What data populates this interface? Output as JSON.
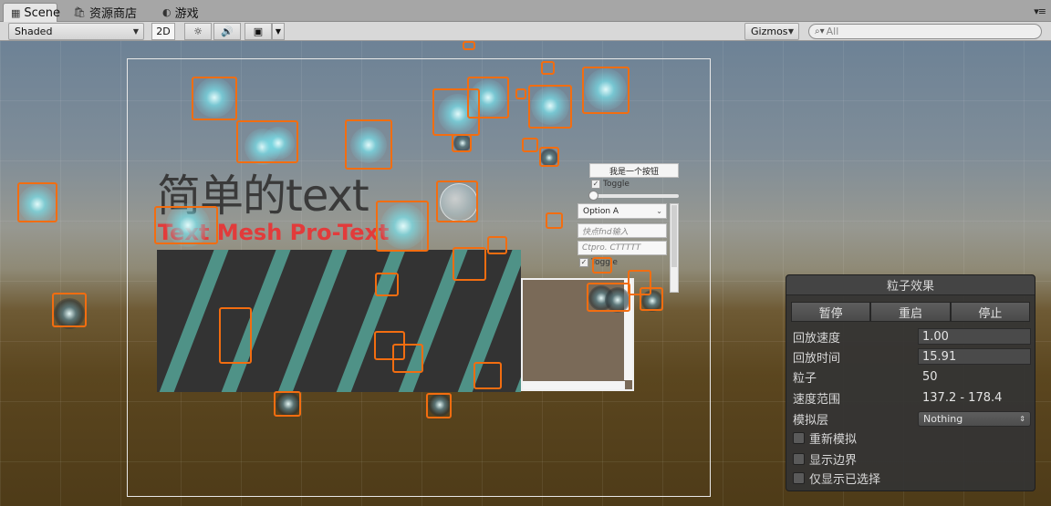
{
  "tabs": [
    {
      "label": "Scene",
      "icon": "scene-icon"
    },
    {
      "label": "资源商店",
      "icon": "store-icon"
    },
    {
      "label": "游戏",
      "icon": "game-icon"
    }
  ],
  "toolbar": {
    "shading_mode": "Shaded",
    "mode_2d": "2D",
    "gizmos": "Gizmos",
    "search_placeholder": "All"
  },
  "scene": {
    "big_text": "简单的text",
    "tmp_text": "Text Mesh Pro-Text",
    "ui_button": "我是一个按钮",
    "ui_toggle_1": "Toggle",
    "ui_dropdown": "Option A",
    "ui_input_1": "快点fnd输入",
    "ui_input_2": "Ctpro. CTTTTT",
    "ui_toggle_2": "Toggle"
  },
  "particle_panel": {
    "title": "粒子效果",
    "pause": "暂停",
    "restart": "重启",
    "stop": "停止",
    "speed_label": "回放速度",
    "speed_value": "1.00",
    "time_label": "回放时间",
    "time_value": "15.91",
    "particles_label": "粒子",
    "particles_value": "50",
    "range_label": "速度范围",
    "range_value": "137.2 - 178.4",
    "layer_label": "模拟层",
    "layer_value": "Nothing",
    "resimulate": "重新模拟",
    "show_bounds": "显示边界",
    "show_selected": "仅显示已选择"
  }
}
